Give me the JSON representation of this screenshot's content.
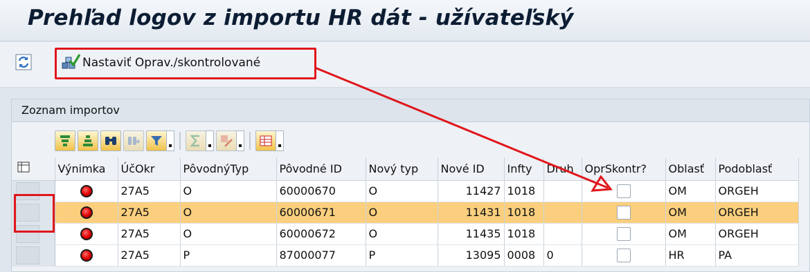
{
  "window": {
    "title": "Prehľad logov z importu HR dát - užívateľský"
  },
  "toolbar": {
    "refresh_icon": "refresh-icon",
    "action_icon": "set-reviewed-icon",
    "action_label": "Nastaviť Oprav./skontrolované"
  },
  "panel": {
    "title": "Zoznam importov"
  },
  "grid_toolbar": {
    "buttons": [
      "sort-ascending-icon",
      "sort-descending-icon",
      "find-icon",
      "find-next-icon",
      "filter-icon",
      "sum-icon",
      "export-icon",
      "layout-icon"
    ]
  },
  "table": {
    "columns": [
      "Výnimka",
      "ÚčOkr",
      "PôvodnýTyp",
      "Pôvodné ID",
      "Nový typ",
      "Nové ID",
      "Infty",
      "Druh",
      "OprSkontr?",
      "Oblasť",
      "Podoblasť"
    ],
    "rows": [
      {
        "status": "red",
        "ucokr": "27A5",
        "ptyp": "O",
        "pid": "60000670",
        "ntyp": "O",
        "nid": "11427",
        "infty": "1018",
        "druh": "",
        "oblast": "OM",
        "podoblast": "ORGEH",
        "selected": false
      },
      {
        "status": "red",
        "ucokr": "27A5",
        "ptyp": "O",
        "pid": "60000671",
        "ntyp": "O",
        "nid": "11431",
        "infty": "1018",
        "druh": "",
        "oblast": "OM",
        "podoblast": "ORGEH",
        "selected": true
      },
      {
        "status": "red",
        "ucokr": "27A5",
        "ptyp": "O",
        "pid": "60000672",
        "ntyp": "O",
        "nid": "11435",
        "infty": "1018",
        "druh": "",
        "oblast": "OM",
        "podoblast": "ORGEH",
        "selected": false
      },
      {
        "status": "red",
        "ucokr": "27A5",
        "ptyp": "P",
        "pid": "87000077",
        "ntyp": "P",
        "nid": "13095",
        "infty": "0008",
        "druh": "0",
        "oblast": "HR",
        "podoblast": "PA",
        "selected": false
      }
    ]
  },
  "colors": {
    "highlight_row": "#fbcf7e",
    "annotation_red": "#e0161b",
    "status_led": "#e00000"
  }
}
